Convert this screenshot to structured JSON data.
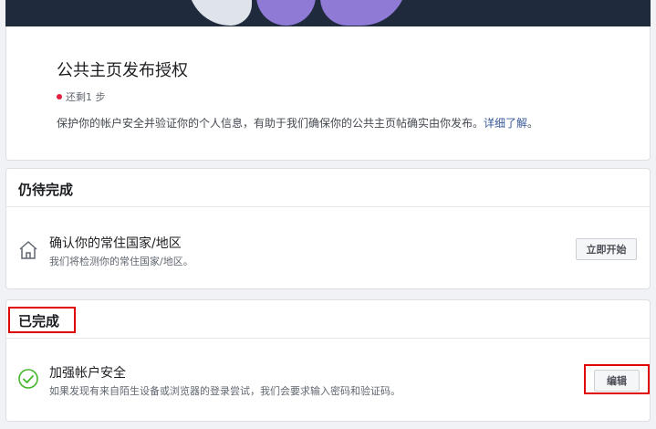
{
  "intro": {
    "title": "公共主页发布授权",
    "remaining": "还剩1 步",
    "description": "保护你的帐户安全并验证你的个人信息，有助于我们确保你的公共主页帖确实由你发布。",
    "learn_more": "详细了解",
    "period": "。"
  },
  "pending": {
    "header": "仍待完成",
    "item": {
      "icon": "home-icon",
      "title": "确认你的常住国家/地区",
      "subtitle": "我们将检测你的常住国家/地区。",
      "button": "立即开始"
    }
  },
  "done": {
    "header": "已完成",
    "item": {
      "icon": "check-circle-icon",
      "title": "加强帐户安全",
      "subtitle": "如果发现有来自陌生设备或浏览器的登录尝试，我们会要求输入密码和验证码。",
      "button": "编辑"
    }
  },
  "colors": {
    "accent_link": "#385898",
    "success": "#42b72a",
    "alert_dot": "#e41e3f",
    "highlight": "#e00000"
  }
}
